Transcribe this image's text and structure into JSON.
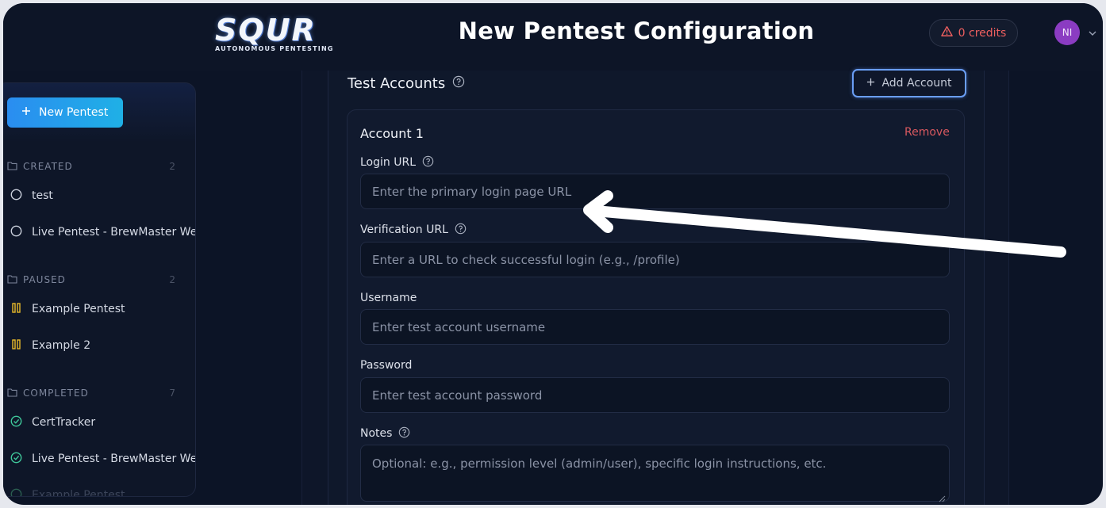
{
  "header": {
    "logo_text": "SQUR",
    "logo_subtitle": "AUTONOMOUS PENTESTING",
    "title": "New Pentest Configuration",
    "credits_label": "0 credits",
    "avatar_initials": "NI"
  },
  "sidebar": {
    "new_button_label": "New Pentest",
    "sections": [
      {
        "label": "CREATED",
        "count": "2",
        "items": [
          {
            "label": "test",
            "status_icon": "circle-outline-icon"
          },
          {
            "label": "Live Pentest - BrewMaster We",
            "status_icon": "circle-outline-icon"
          }
        ]
      },
      {
        "label": "PAUSED",
        "count": "2",
        "items": [
          {
            "label": "Example Pentest",
            "status_icon": "pause-icon"
          },
          {
            "label": "Example 2",
            "status_icon": "pause-icon"
          }
        ]
      },
      {
        "label": "COMPLETED",
        "count": "7",
        "items": [
          {
            "label": "CertTracker",
            "status_icon": "check-circle-icon"
          },
          {
            "label": "Live Pentest - BrewMaster We",
            "status_icon": "check-circle-icon"
          },
          {
            "label": "Example Pentest",
            "status_icon": "check-circle-icon"
          }
        ]
      }
    ]
  },
  "main": {
    "section_title": "Test Accounts",
    "add_account_label": "Add Account",
    "account": {
      "title": "Account 1",
      "remove_label": "Remove",
      "fields": {
        "login_url": {
          "label": "Login URL",
          "placeholder": "Enter the primary login page URL",
          "value": ""
        },
        "verification_url": {
          "label": "Verification URL",
          "placeholder": "Enter a URL to check successful login (e.g., /profile)",
          "value": ""
        },
        "username": {
          "label": "Username",
          "placeholder": "Enter test account username",
          "value": ""
        },
        "password": {
          "label": "Password",
          "placeholder": "Enter test account password",
          "value": ""
        },
        "notes": {
          "label": "Notes",
          "placeholder": "Optional: e.g., permission level (admin/user), specific login instructions, etc.",
          "value": ""
        }
      }
    }
  },
  "colors": {
    "accent_blue": "#2a8df0",
    "danger_red": "#ef5f5f",
    "paused_yellow": "#e8b92a",
    "completed_green": "#3fc79a",
    "avatar_purple": "#8b3cc2"
  }
}
